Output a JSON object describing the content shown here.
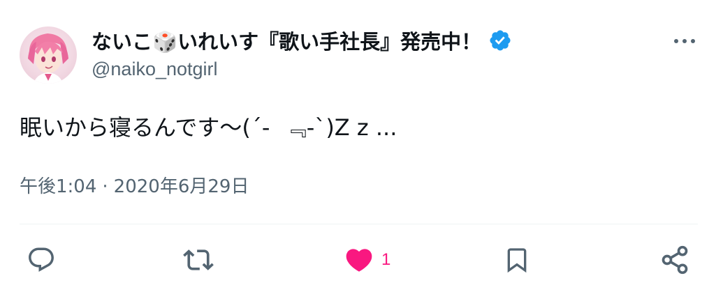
{
  "tweet": {
    "display_name": "ないこ🎲いれいす『歌い手社長』発売中！",
    "handle": "@naiko_notgirl",
    "body": "眠いから寝るんです〜(´- ﻿ ﹃-`)Z z ...",
    "time": "午後1:04",
    "separator": "·",
    "date": "2020年6月29日",
    "verified": true
  },
  "actions": {
    "reply_icon": "reply-icon",
    "retweet_icon": "retweet-icon",
    "like_icon": "heart-icon",
    "like_count": "1",
    "bookmark_icon": "bookmark-icon",
    "share_icon": "share-icon"
  },
  "colors": {
    "verified_blue": "#1d9bf0",
    "like_pink": "#f91880",
    "secondary_text": "#536471",
    "icon_gray": "#536471"
  }
}
